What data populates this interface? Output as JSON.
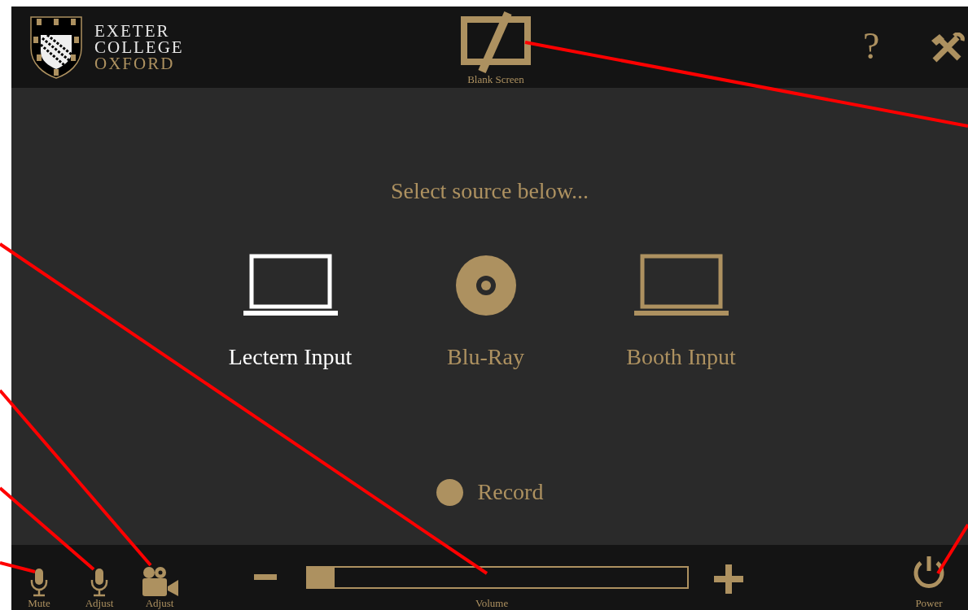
{
  "header": {
    "logo_lines": [
      "EXETER",
      "COLLEGE",
      "OXFORD"
    ],
    "blank_screen": {
      "label": "Blank Screen"
    },
    "help": "?"
  },
  "prompt": "Select source below...",
  "sources": [
    {
      "label": "Lectern Input",
      "kind": "laptop",
      "selected": true
    },
    {
      "label": "Blu-Ray",
      "kind": "disc",
      "selected": false
    },
    {
      "label": "Booth Input",
      "kind": "laptop",
      "selected": false
    }
  ],
  "record": {
    "label": "Record"
  },
  "footer": {
    "controls": [
      {
        "label": "Mute",
        "kind": "mic"
      },
      {
        "label": "Adjust",
        "kind": "mic"
      },
      {
        "label": "Adjust",
        "kind": "camera"
      }
    ],
    "volume": {
      "label": "Volume",
      "level": 0.07
    },
    "power": {
      "label": "Power"
    }
  }
}
